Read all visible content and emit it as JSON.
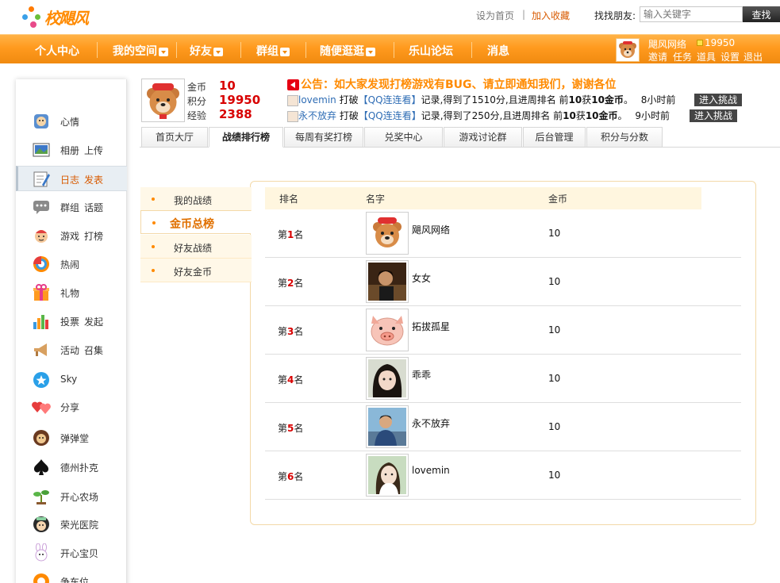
{
  "header": {
    "logo_text": "校飓风",
    "links": {
      "set_home": "设为首页",
      "separator": "|",
      "add_favorite": "加入收藏"
    },
    "search": {
      "label": "找找朋友:",
      "placeholder": "输入关键字",
      "button": "查找"
    }
  },
  "nav": {
    "items": [
      "个人中心",
      "我的空间",
      "好友",
      "群组",
      "随便逛逛",
      "乐山论坛",
      "消息"
    ],
    "user": {
      "name": "飓风网络",
      "coins": "19950",
      "links": [
        "邀请",
        "任务",
        "道具",
        "设置",
        "退出"
      ]
    }
  },
  "sidebar": {
    "items": [
      {
        "label": "心情",
        "extra": "",
        "icon": "mood-icon"
      },
      {
        "label": "相册",
        "extra": "上传",
        "icon": "photo-album-icon"
      },
      {
        "label": "日志",
        "extra": "发表",
        "icon": "journal-pen-icon"
      },
      {
        "label": "群组",
        "extra": "话题",
        "icon": "group-chat-icon"
      },
      {
        "label": "游戏",
        "extra": "打榜",
        "icon": "game-icon"
      },
      {
        "label": "热闹",
        "extra": "",
        "icon": "lively-icon"
      },
      {
        "label": "礼物",
        "extra": "",
        "icon": "gift-icon"
      },
      {
        "label": "投票",
        "extra": "发起",
        "icon": "vote-chart-icon"
      },
      {
        "label": "活动",
        "extra": "召集",
        "icon": "event-horn-icon"
      },
      {
        "label": "Sky",
        "extra": "",
        "icon": "sky-icon"
      },
      {
        "label": "分享",
        "extra": "",
        "icon": "share-hearts-icon"
      },
      {
        "label": "弹弹堂",
        "extra": "",
        "icon": "ddt-game-icon"
      },
      {
        "label": "德州扑克",
        "extra": "",
        "icon": "poker-spade-icon"
      },
      {
        "label": "开心农场",
        "extra": "",
        "icon": "farm-sprout-icon"
      },
      {
        "label": "荣光医院",
        "extra": "",
        "icon": "hospital-icon"
      },
      {
        "label": "开心宝贝",
        "extra": "",
        "icon": "happy-baby-icon"
      },
      {
        "label": "争车位",
        "extra": "",
        "icon": "parking-icon"
      }
    ]
  },
  "profile": {
    "stats": [
      {
        "label": "金币",
        "value": "10"
      },
      {
        "label": "积分",
        "value": "19950"
      },
      {
        "label": "经验",
        "value": "2388"
      }
    ]
  },
  "notice": {
    "text": "公告：如大家发现打榜游戏有BUG、请立即通知我们，谢谢各位"
  },
  "records": [
    {
      "user": "lovemin",
      "t1": " 打破",
      "game": "【QQ连连看】",
      "t2": "记录,得到了1510分,且进周排名 前",
      "rank": "10",
      "t3": "获",
      "reward": "10金币",
      "t4": "。",
      "time": "8小时前",
      "button": "进入挑战"
    },
    {
      "user": "永不放弃",
      "t1": " 打破",
      "game": "【QQ连连看】",
      "t2": "记录,得到了250分,且进周排名 前",
      "rank": "10",
      "t3": "获",
      "reward": "10金币",
      "t4": "。",
      "time": "9小时前",
      "button": "进入挑战"
    }
  ],
  "tabs": [
    "首页大厅",
    "战绩排行榜",
    "每周有奖打榜",
    "兑奖中心",
    "游戏讨论群",
    "后台管理",
    "积分与分数"
  ],
  "submenu": [
    "我的战绩",
    "金币总榜",
    "好友战绩",
    "好友金币"
  ],
  "ranking": {
    "headers": {
      "rank": "排名",
      "name": "名字",
      "coins": "金币"
    },
    "rows": [
      {
        "prefix": "第",
        "num": "1",
        "suffix": "名",
        "name": "飓风网络",
        "coins": "10"
      },
      {
        "prefix": "第",
        "num": "2",
        "suffix": "名",
        "name": "女女",
        "coins": "10"
      },
      {
        "prefix": "第",
        "num": "3",
        "suffix": "名",
        "name": "拓拔孤星",
        "coins": "10"
      },
      {
        "prefix": "第",
        "num": "4",
        "suffix": "名",
        "name": "乖乖",
        "coins": "10"
      },
      {
        "prefix": "第",
        "num": "5",
        "suffix": "名",
        "name": "永不放弃",
        "coins": "10"
      },
      {
        "prefix": "第",
        "num": "6",
        "suffix": "名",
        "name": "lovemin",
        "coins": "10"
      }
    ]
  },
  "colors": {
    "nav_orange": "#ff9a1e",
    "accent_red": "#d80000",
    "notice_orange": "#ff8a00",
    "link_blue": "#2f6db5"
  }
}
